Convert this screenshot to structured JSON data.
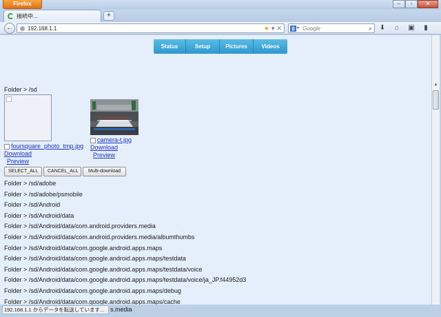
{
  "browser": {
    "app_button": "Firefox",
    "tab_title": "接続中...",
    "new_tab": "+",
    "window_buttons": {
      "minimize": "–",
      "maximize": "▫",
      "close": "✕"
    },
    "back": "←",
    "url": "192.168.1.1",
    "url_icons": {
      "bookmark": "★",
      "dropdown": "▾",
      "stop": "✕"
    },
    "search_engine_letter": "g",
    "search_placeholder": "Google",
    "search_go": "⌕",
    "nav_icons": {
      "download": "⬇",
      "home": "⌂",
      "menu": "▣",
      "bookmarks": "▮"
    },
    "status_text": "192.168.1.1 からデータを転送しています...",
    "status_tail": "s.media"
  },
  "menu": [
    "Status",
    "Setup",
    "Pictures",
    "Videos"
  ],
  "current_folder": "Folder > /sd",
  "files": [
    {
      "name": "foursquare_photo_tmp.jpg",
      "download": "Download",
      "preview": "Preview"
    },
    {
      "name": "camera-t.jpg",
      "download": "Download",
      "preview": "Preview"
    }
  ],
  "buttons": {
    "select_all": "SELECT_ALL",
    "cancel_all": "CANCEL_ALL",
    "multi_download": "Multi-download"
  },
  "folders": [
    "Folder > /sd/adobe",
    "Folder > /sd/adobe/psmobile",
    "Folder > /sd/Android",
    "Folder > /sd/Android/data",
    "Folder > /sd/Android/data/com.android.providers.media",
    "Folder > /sd/Android/data/com.android.providers.media/albumthumbs",
    "Folder > /sd/Android/data/com.google.android.apps.maps",
    "Folder > /sd/Android/data/com.google.android.apps.maps/testdata",
    "Folder > /sd/Android/data/com.google.android.apps.maps/testdata/voice",
    "Folder > /sd/Android/data/com.google.android.apps.maps/testdata/voice/ja_JP.f44952d3",
    "Folder > /sd/Android/data/com.google.android.apps.maps/debug",
    "Folder > /sd/Android/data/com.google.android.apps.maps/cache"
  ]
}
